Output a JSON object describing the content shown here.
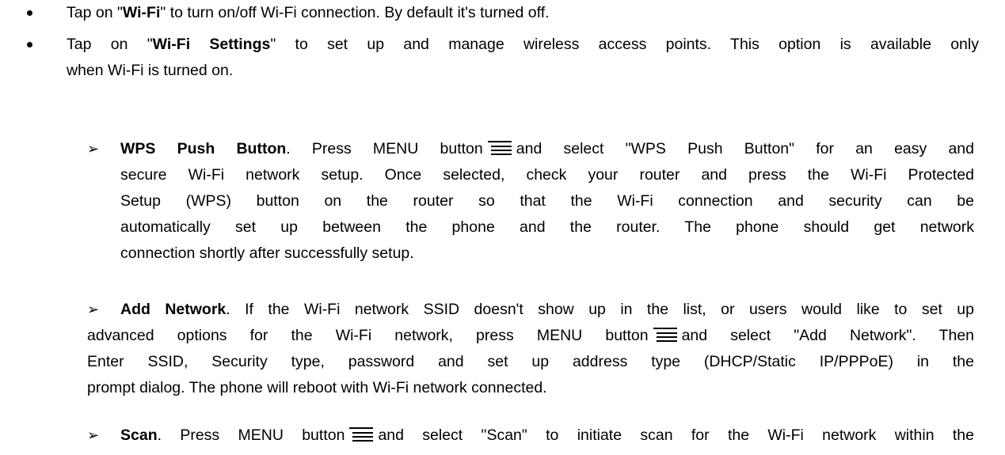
{
  "bullets": [
    {
      "prefix": "Tap on \"",
      "bold": "Wi-Fi",
      "suffix": "\" to turn on/off Wi-Fi connection. By default it's turned off."
    },
    {
      "prefix": "Tap on \"",
      "bold": "Wi-Fi Settings",
      "suffix_line1": "\" to set up and manage wireless access points. This option is available only",
      "line2": "when Wi-Fi is turned on."
    }
  ],
  "sub_items": [
    {
      "title": "WPS Push Button",
      "line1_a": ". Press MENU button",
      "line1_b": "and select \"WPS Push Button\" for an easy and",
      "lines": [
        "secure Wi-Fi network setup. Once selected, check your router and press the Wi-Fi Protected",
        "Setup (WPS) button on the router so that the Wi-Fi connection and security can be",
        "automatically set up between the phone and the router. The phone should get network",
        "connection shortly after successfully setup."
      ]
    },
    {
      "title": "Add Network",
      "line1_a": ". If the Wi-Fi network SSID doesn't show up in the list, or users would like to set up",
      "line2_a": "advanced options for the Wi-Fi network, press MENU button",
      "line2_b": "and select \"Add Network\". Then",
      "lines": [
        "Enter SSID, Security type, password and set up address type (DHCP/Static IP/PPPoE) in the",
        "prompt dialog. The phone will reboot with Wi-Fi network connected."
      ]
    },
    {
      "title": "Scan",
      "line1_a": ". Press MENU button",
      "line1_b": "and select \"Scan\" to initiate scan for the Wi-Fi network within the"
    }
  ],
  "icons": {
    "bullet": "disc-bullet",
    "sub_bullet": "arrow-bullet",
    "menu": "menu-icon"
  },
  "arrow_glyph": "➢"
}
